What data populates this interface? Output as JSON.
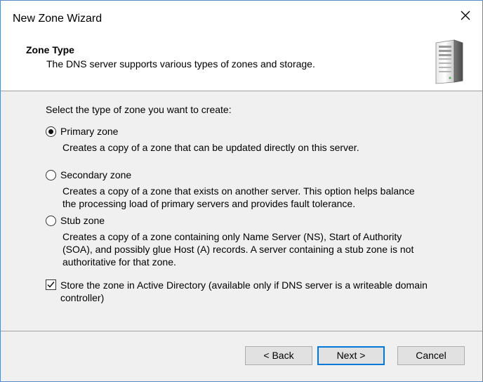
{
  "window": {
    "title": "New Zone Wizard"
  },
  "header": {
    "title": "Zone Type",
    "subtitle": "The DNS server supports various types of zones and storage."
  },
  "content": {
    "intro": "Select the type of zone you want to create:",
    "options": [
      {
        "label": "Primary zone",
        "selected": true,
        "description": [
          "Creates a copy of a zone that can be updated directly on this server."
        ]
      },
      {
        "label": "Secondary zone",
        "selected": false,
        "description": [
          "Creates a copy of a zone that exists on another server. This option helps balance",
          "the processing load of primary servers and provides fault tolerance."
        ]
      },
      {
        "label": "Stub zone",
        "selected": false,
        "description": [
          "Creates a copy of a zone containing only Name Server (NS), Start of Authority",
          "(SOA), and possibly glue Host (A) records. A server containing a stub zone is not",
          "authoritative for that zone."
        ]
      }
    ],
    "store_ad": {
      "checked": true,
      "label_lines": [
        "Store the zone in Active Directory (available only if DNS server is a writeable domain",
        "controller)"
      ]
    }
  },
  "footer": {
    "back_label": "< Back",
    "next_label": "Next >",
    "cancel_label": "Cancel"
  },
  "icons": {
    "close": "close-icon",
    "server": "server-icon",
    "checkmark": "checkmark-icon"
  },
  "colors": {
    "accent": "#0078d7",
    "content_bg": "#f0f0f0",
    "button_bg": "#e1e1e1"
  }
}
